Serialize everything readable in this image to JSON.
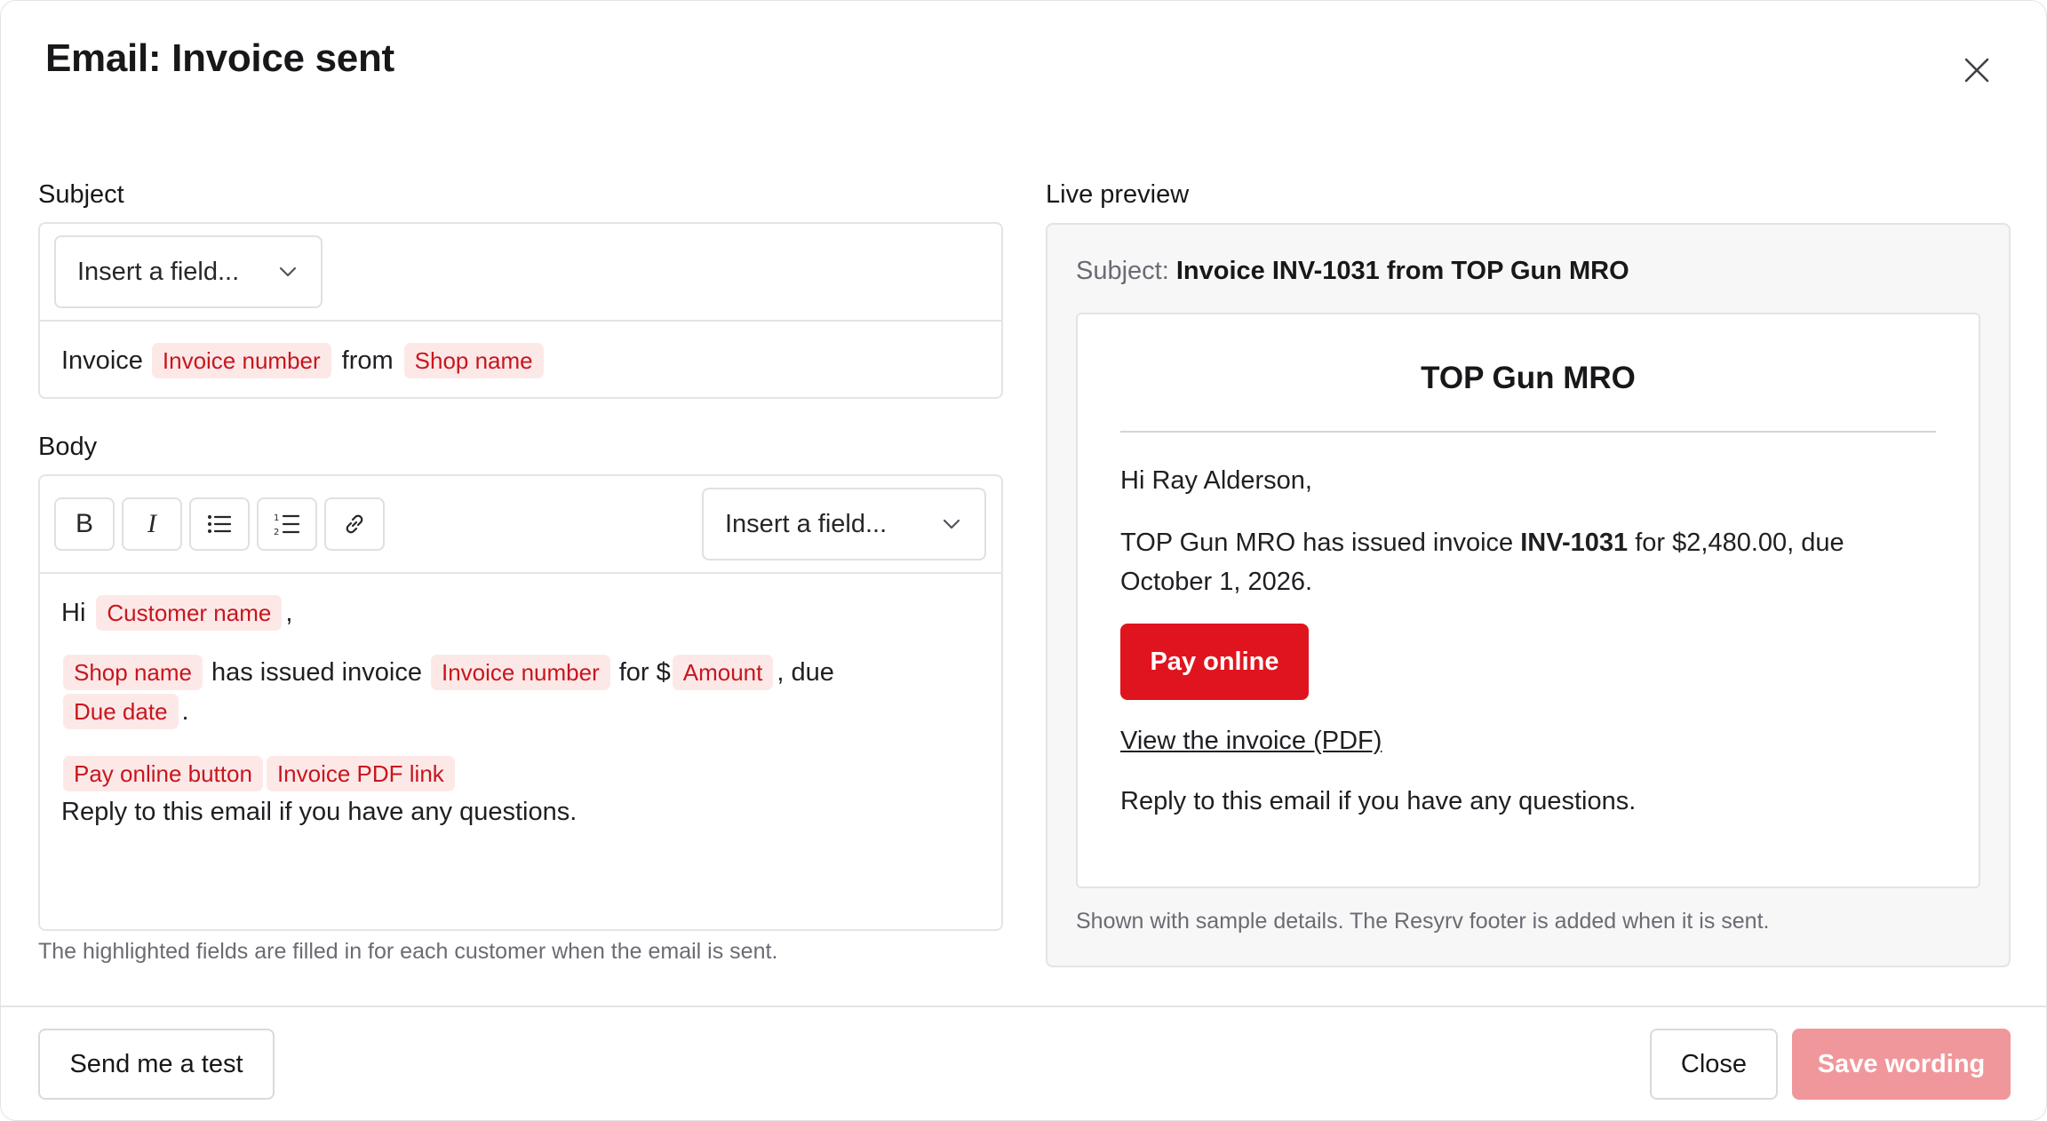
{
  "modal": {
    "title": "Email: Invoice sent"
  },
  "subject": {
    "label": "Subject",
    "insert_field": "Insert a field...",
    "parts": {
      "t1": "Invoice",
      "chip1": "Invoice number",
      "t2": "from",
      "chip2": "Shop name"
    }
  },
  "body": {
    "label": "Body",
    "insert_field": "Insert a field...",
    "toolbar": {
      "bold": "B",
      "italic": "I"
    },
    "line1": {
      "t1": "Hi",
      "chip1": "Customer name",
      "t2": ","
    },
    "line2": {
      "chip1": "Shop name",
      "t1": "has issued invoice",
      "chip2": "Invoice number",
      "t2": "for $",
      "chip3": "Amount",
      "t3": ", due"
    },
    "line3": {
      "chip1": "Due date",
      "t1": "."
    },
    "line4": {
      "chip1": "Pay online button",
      "chip2": "Invoice PDF link"
    },
    "line5": "Reply to this email if you have any questions.",
    "help": "The highlighted fields are filled in for each customer when the email is sent."
  },
  "preview": {
    "label": "Live preview",
    "subject_prefix": "Subject:",
    "subject_value": "Invoice INV-1031 from TOP Gun MRO",
    "shop_name": "TOP Gun MRO",
    "greeting": "Hi Ray Alderson,",
    "line_a1": "TOP Gun MRO has issued invoice",
    "line_a_bold": "INV-1031",
    "line_a2": "for $2,480.00, due",
    "line_b": "October 1, 2026.",
    "pay_button": "Pay online",
    "pdf_link": "View the invoice (PDF)",
    "reply": "Reply to this email if you have any questions.",
    "note": "Shown with sample details. The Resyrv footer is added when it is sent."
  },
  "footer": {
    "send_test": "Send me a test",
    "close": "Close",
    "save": "Save wording"
  },
  "colors": {
    "accent": "#e0141e",
    "chip_bg": "#fde8e8",
    "chip_text": "#c8161d",
    "save_disabled": "#f0979b"
  }
}
